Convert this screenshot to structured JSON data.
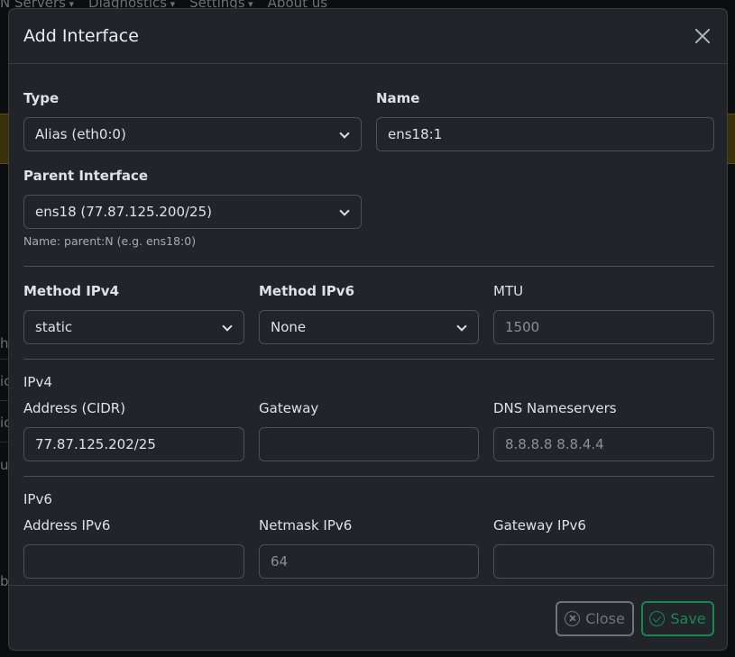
{
  "background": {
    "nav": [
      "N Servers",
      "Diagnostics",
      "Settings",
      "About us"
    ],
    "stubs": [
      "h",
      "ic",
      "ic",
      "u",
      "b"
    ]
  },
  "modal": {
    "title": "Add Interface",
    "type": {
      "label": "Type",
      "value": "Alias (eth0:0)"
    },
    "name": {
      "label": "Name",
      "value": "ens18:1"
    },
    "parent": {
      "label": "Parent Interface",
      "value": "ens18 (77.87.125.200/25)",
      "hint": "Name: parent:N (e.g. ens18:0)"
    },
    "method_ipv4": {
      "label": "Method IPv4",
      "value": "static"
    },
    "method_ipv6": {
      "label": "Method IPv6",
      "value": "None"
    },
    "mtu": {
      "label": "MTU",
      "value": "1500"
    },
    "ipv4": {
      "title": "IPv4",
      "address": {
        "label": "Address (CIDR)",
        "value": "77.87.125.202/25"
      },
      "gateway": {
        "label": "Gateway",
        "value": ""
      },
      "dns": {
        "label": "DNS Nameservers",
        "value": "8.8.8.8 8.8.4.4"
      }
    },
    "ipv6": {
      "title": "IPv6",
      "address": {
        "label": "Address IPv6",
        "value": ""
      },
      "netmask": {
        "label": "Netmask IPv6",
        "value": "64"
      },
      "gateway": {
        "label": "Gateway IPv6",
        "value": ""
      }
    },
    "footer": {
      "close_label": "Close",
      "save_label": "Save"
    }
  },
  "icons": [
    "close-icon",
    "chevron-down-icon",
    "x-circle-icon",
    "check-circle-icon"
  ],
  "colors": {
    "modal_bg": "#212529",
    "border": "#495057",
    "save": "#198754",
    "close": "#6c757d"
  }
}
